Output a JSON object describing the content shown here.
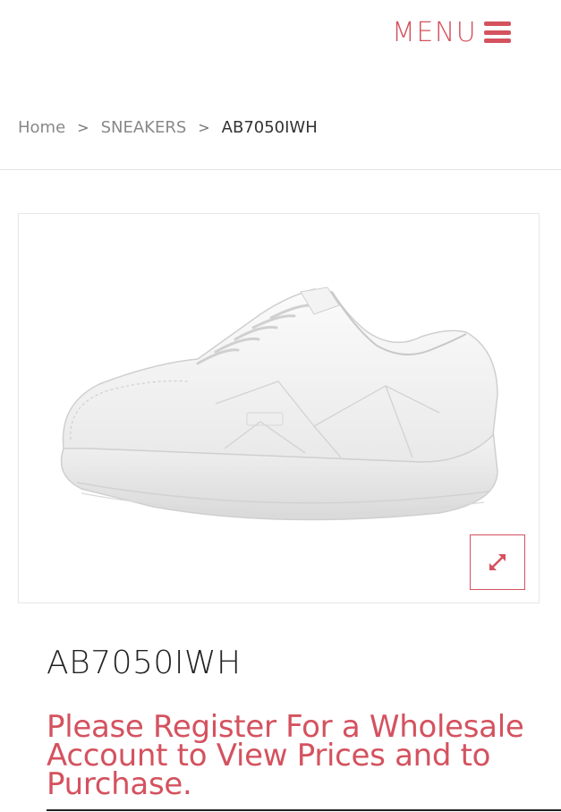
{
  "header": {
    "menu_label": "MENU",
    "menu_icon": "hamburger-icon",
    "accent_color": "#d4525f"
  },
  "breadcrumb": {
    "items": [
      "Home",
      "SNEAKERS",
      "AB7050IWH"
    ],
    "separator": ">"
  },
  "product": {
    "image_description_icon": "white-sneaker-image",
    "expand_icon": "expand-arrows-icon",
    "title": "AB7050IWH",
    "notice": "Please Register For a Wholesale Account to View Prices and to Purchase."
  }
}
